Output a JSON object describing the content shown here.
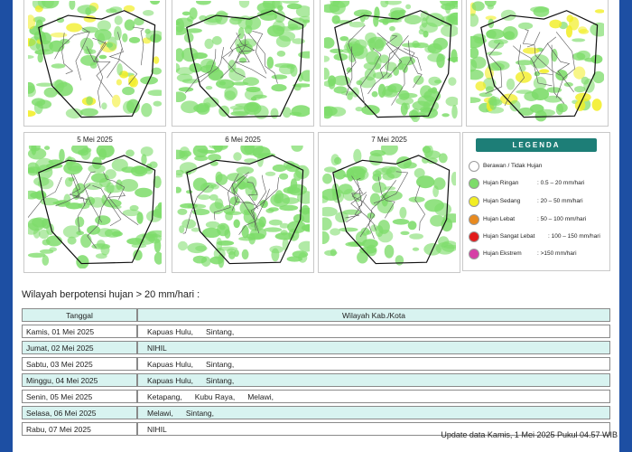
{
  "maps": {
    "top_row": [
      {
        "date": ""
      },
      {
        "date": ""
      },
      {
        "date": ""
      },
      {
        "date": ""
      }
    ],
    "bottom_row": [
      {
        "date": "5 Mei 2025"
      },
      {
        "date": "6 Mei 2025"
      },
      {
        "date": "7 Mei 2025"
      }
    ]
  },
  "legend": {
    "title": "LEGENDA",
    "items": [
      {
        "name": "Berawan / Tidak Hujan",
        "range": "",
        "color": "#ffffff"
      },
      {
        "name": "Hujan Ringan",
        "range": ": 0.5 – 20 mm/hari",
        "color": "#7ddc6a"
      },
      {
        "name": "Hujan Sedang",
        "range": ": 20 – 50 mm/hari",
        "color": "#f2ee24"
      },
      {
        "name": "Hujan Lebat",
        "range": ": 50 – 100 mm/hari",
        "color": "#e88a1f"
      },
      {
        "name": "Hujan Sangat Lebat",
        "range": ": 100 – 150 mm/hari",
        "color": "#e21b1b"
      },
      {
        "name": "Hujan Ekstrem",
        "range": ": >150 mm/hari",
        "color": "#d63fa6"
      }
    ]
  },
  "summary": {
    "title": "Wilayah berpotensi hujan > 20 mm/hari :",
    "columns": [
      "Tanggal",
      "Wilayah Kab./Kota"
    ],
    "rows": [
      {
        "day": "Kamis, 01 Mei 2025",
        "regions": [
          "Kapuas Hulu,",
          "Sintang,"
        ]
      },
      {
        "day": "Jumat, 02 Mei 2025",
        "regions": [
          "NIHIL"
        ]
      },
      {
        "day": "Sabtu, 03 Mei 2025",
        "regions": [
          "Kapuas Hulu,",
          "Sintang,"
        ]
      },
      {
        "day": "Minggu, 04 Mei 2025",
        "regions": [
          "Kapuas Hulu,",
          "Sintang,"
        ]
      },
      {
        "day": "Senin, 05 Mei 2025",
        "regions": [
          "Ketapang,",
          "Kubu Raya,",
          "Melawi,"
        ]
      },
      {
        "day": "Selasa, 06 Mei 2025",
        "regions": [
          "Melawi,",
          "Sintang,"
        ]
      },
      {
        "day": "Rabu, 07 Mei 2025",
        "regions": [
          "NIHIL"
        ]
      }
    ]
  },
  "update_text": "Update data Kamis, 1 Mei 2025 Pukul 04.57 WIB",
  "colors": {
    "brand_blue": "#1d4fa3",
    "legend_header": "#1d7e77",
    "row_alt": "#d8f3f0"
  }
}
